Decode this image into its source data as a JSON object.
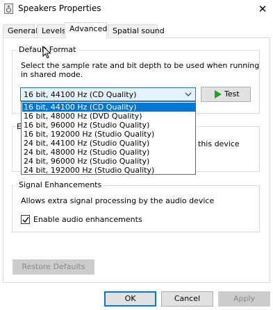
{
  "window": {
    "title": "Speakers Properties",
    "close_glyph": "✕",
    "icon": "speaker-icon"
  },
  "tabs": [
    {
      "label": "General",
      "active": false
    },
    {
      "label": "Levels",
      "active": false
    },
    {
      "label": "Advanced",
      "active": true
    },
    {
      "label": "Spatial sound",
      "active": false
    }
  ],
  "default_format": {
    "legend": "Default Format",
    "description_line1": "Select the sample rate and bit depth to be used when running",
    "description_line2": "in shared mode.",
    "selected": "16 bit, 44100 Hz (CD Quality)",
    "test_label": "Test",
    "options": [
      "16 bit, 44100 Hz (CD Quality)",
      "16 bit, 48000 Hz (DVD Quality)",
      "16 bit, 96000 Hz (Studio Quality)",
      "16 bit, 192000 Hz (Studio Quality)",
      "24 bit, 44100 Hz (Studio Quality)",
      "24 bit, 48000 Hz (Studio Quality)",
      "24 bit, 96000 Hz (Studio Quality)",
      "24 bit, 192000 Hz (Studio Quality)"
    ]
  },
  "exclusive_mode": {
    "legend_fragment": "E",
    "text_fragment": "this device"
  },
  "signal_enhancements": {
    "legend": "Signal Enhancements",
    "description": "Allows extra signal processing by the audio device",
    "checkbox_label": "Enable audio enhancements",
    "checked": true
  },
  "buttons": {
    "restore_defaults": "Restore Defaults",
    "ok": "OK",
    "cancel": "Cancel",
    "apply": "Apply"
  },
  "colors": {
    "accent": "#0078d7",
    "test_play": "#1aa12b"
  }
}
